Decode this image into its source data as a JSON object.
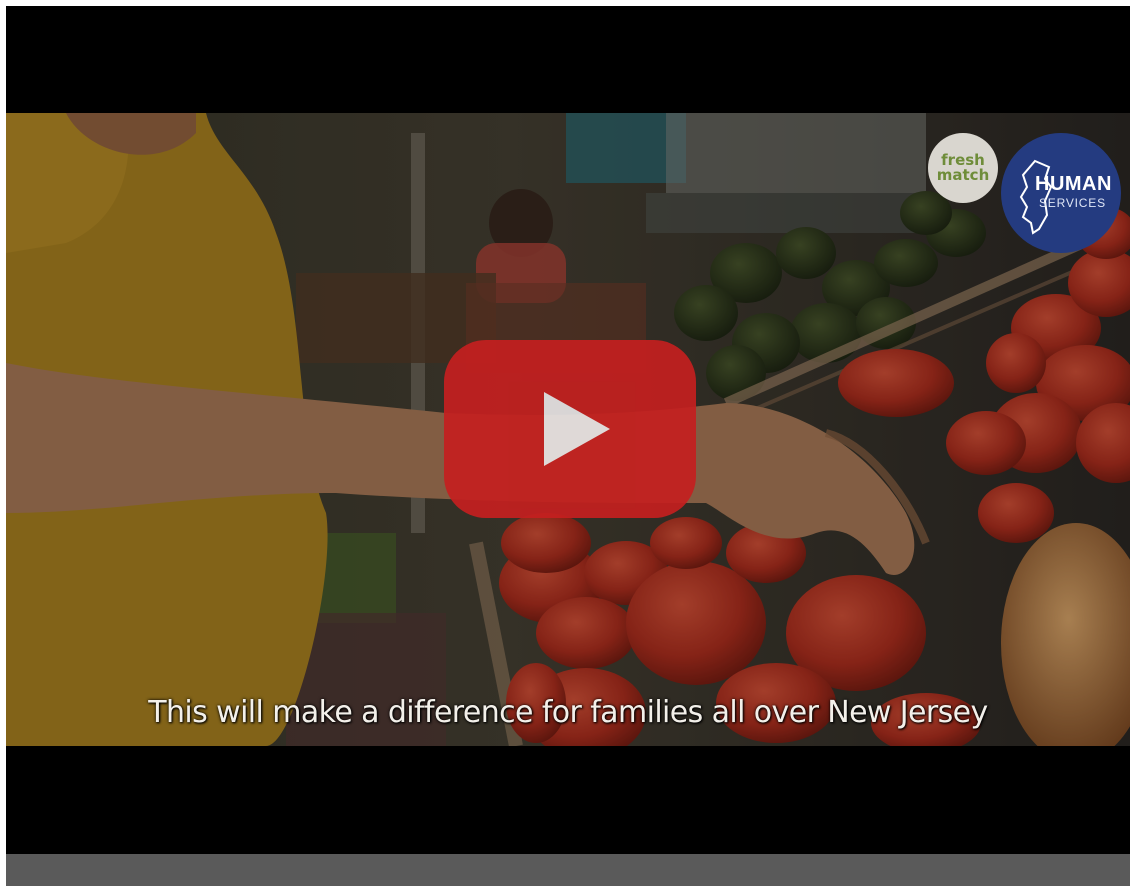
{
  "video": {
    "caption": "This will make a difference for families all over New Jersey",
    "play_button_label": "Play",
    "icons": [
      "play-icon"
    ]
  },
  "logos": {
    "freshmatch": {
      "line1": "fresh",
      "line2": "match"
    },
    "human_services": {
      "line1": "HUMAN",
      "line2": "SERVICES"
    }
  },
  "colors": {
    "play_button": "#c4201f",
    "human_services_badge": "#243b80",
    "freshmatch_text": "#6f8d3a",
    "control_bar": "#5a5a5a"
  }
}
